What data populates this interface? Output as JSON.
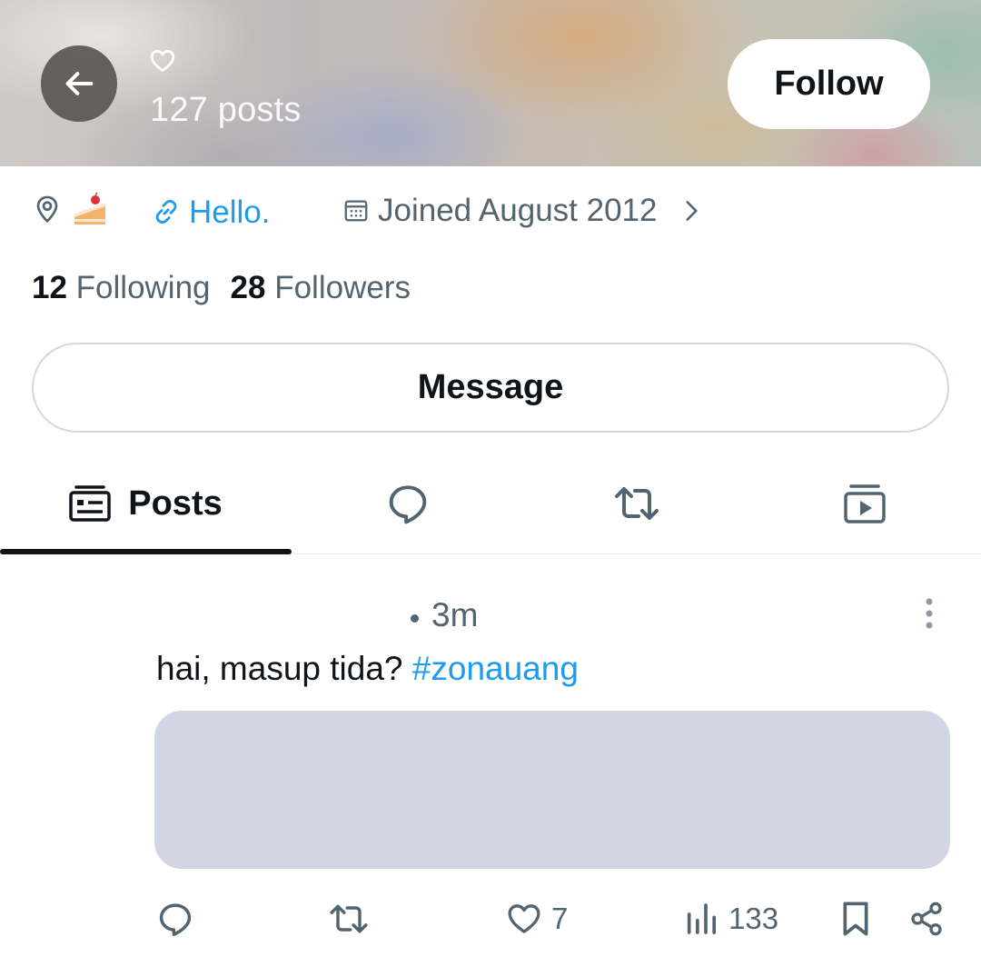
{
  "header": {
    "back_icon": "arrow-left-icon",
    "heart_icon": "heart-outline-icon",
    "post_count": "127 posts",
    "follow_label": "Follow"
  },
  "profile": {
    "location_icon": "map-pin-icon",
    "location_emoji_icon": "cake-slice-icon",
    "website_label": "Hello.",
    "joined_label": "Joined August 2012",
    "following_count": "12",
    "following_label": "Following",
    "followers_count": "28",
    "followers_label": "Followers",
    "message_label": "Message"
  },
  "tabs": {
    "active": "posts",
    "posts_label": "Posts",
    "items": [
      "posts-icon",
      "replies-icon",
      "reposts-icon",
      "media-icon"
    ]
  },
  "post": {
    "time": "3m",
    "text": "hai, masup tida? ",
    "hashtag": "#zonauang",
    "likes": "7",
    "views": "133"
  },
  "colors": {
    "accent": "#1d9bf0",
    "text_primary": "#0f1419",
    "text_secondary": "#536471",
    "media_placeholder": "#d2d5e3",
    "border": "#cfd9de"
  }
}
